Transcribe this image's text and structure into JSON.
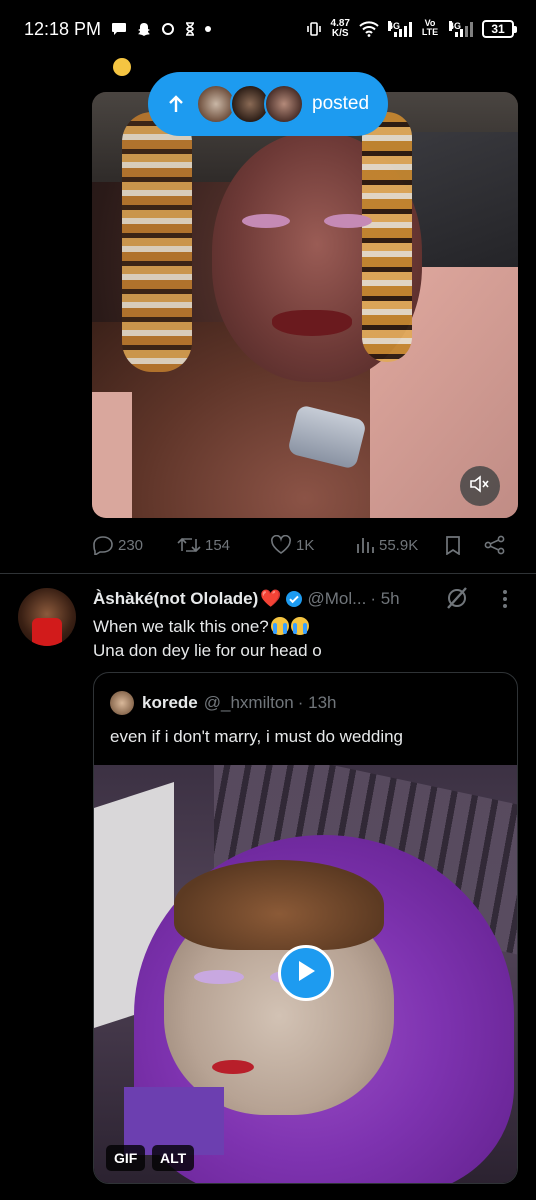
{
  "status_bar": {
    "time": "12:18 PM",
    "net_speed_value": "4.87",
    "net_speed_unit": "K/S",
    "network_1": "4G",
    "volte": "Vo LTE",
    "network_2": "4G",
    "battery": "31"
  },
  "tweet1": {
    "posted_pill_label": "posted",
    "reply_count": "230",
    "retweet_count": "154",
    "like_count": "1K",
    "view_count": "55.9K"
  },
  "tweet2": {
    "display_name": "Àshàké(not Ololade)",
    "heart_emoji": "❤️",
    "handle": "@Mol...",
    "time": "· 5h",
    "text_line1": "When we talk this one?",
    "text_line2": "Una don dey lie for our head o",
    "quoted": {
      "display_name": "korede",
      "handle": "@_hxmilton",
      "time": "· 13h",
      "text": "even if i don't marry, i must do wedding",
      "badge_gif": "GIF",
      "badge_alt": "ALT"
    }
  },
  "colors": {
    "accent": "#1d9bf0",
    "muted_text": "#71767b",
    "background": "#000000"
  }
}
